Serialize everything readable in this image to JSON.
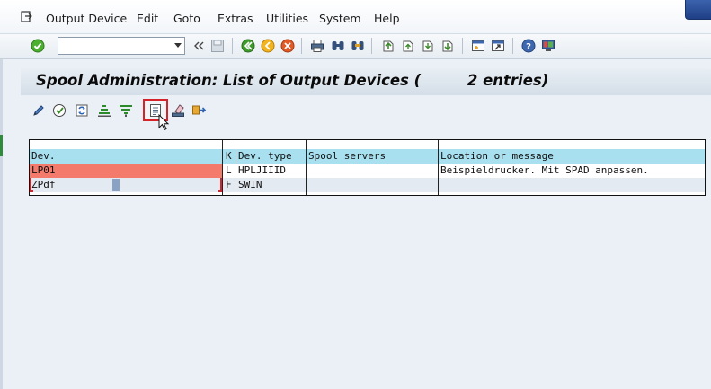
{
  "menu": {
    "items": [
      {
        "label": "Output Device"
      },
      {
        "label": "Edit"
      },
      {
        "label": "Goto"
      },
      {
        "label": "Extras"
      },
      {
        "label": "Utilities"
      },
      {
        "label": "System"
      },
      {
        "label": "Help"
      }
    ]
  },
  "command_field": {
    "value": ""
  },
  "title": "Spool Administration: List of Output Devices (         2 entries)",
  "table": {
    "columns": [
      "Dev.",
      "K",
      "Dev. type",
      "Spool servers",
      "Location or message"
    ],
    "rows": [
      {
        "dev": "LP01",
        "k": "L",
        "type": "HPLJIIID",
        "servers": "",
        "location": "Beispieldrucker. Mit SPAD anpassen."
      },
      {
        "dev": "ZPdf",
        "k": "F",
        "type": "SWIN",
        "servers": "",
        "location": ""
      }
    ]
  },
  "colors": {
    "header_row": "#a8e0f0",
    "selected_row": "#f47b6b",
    "highlight_box": "#d6232a"
  }
}
